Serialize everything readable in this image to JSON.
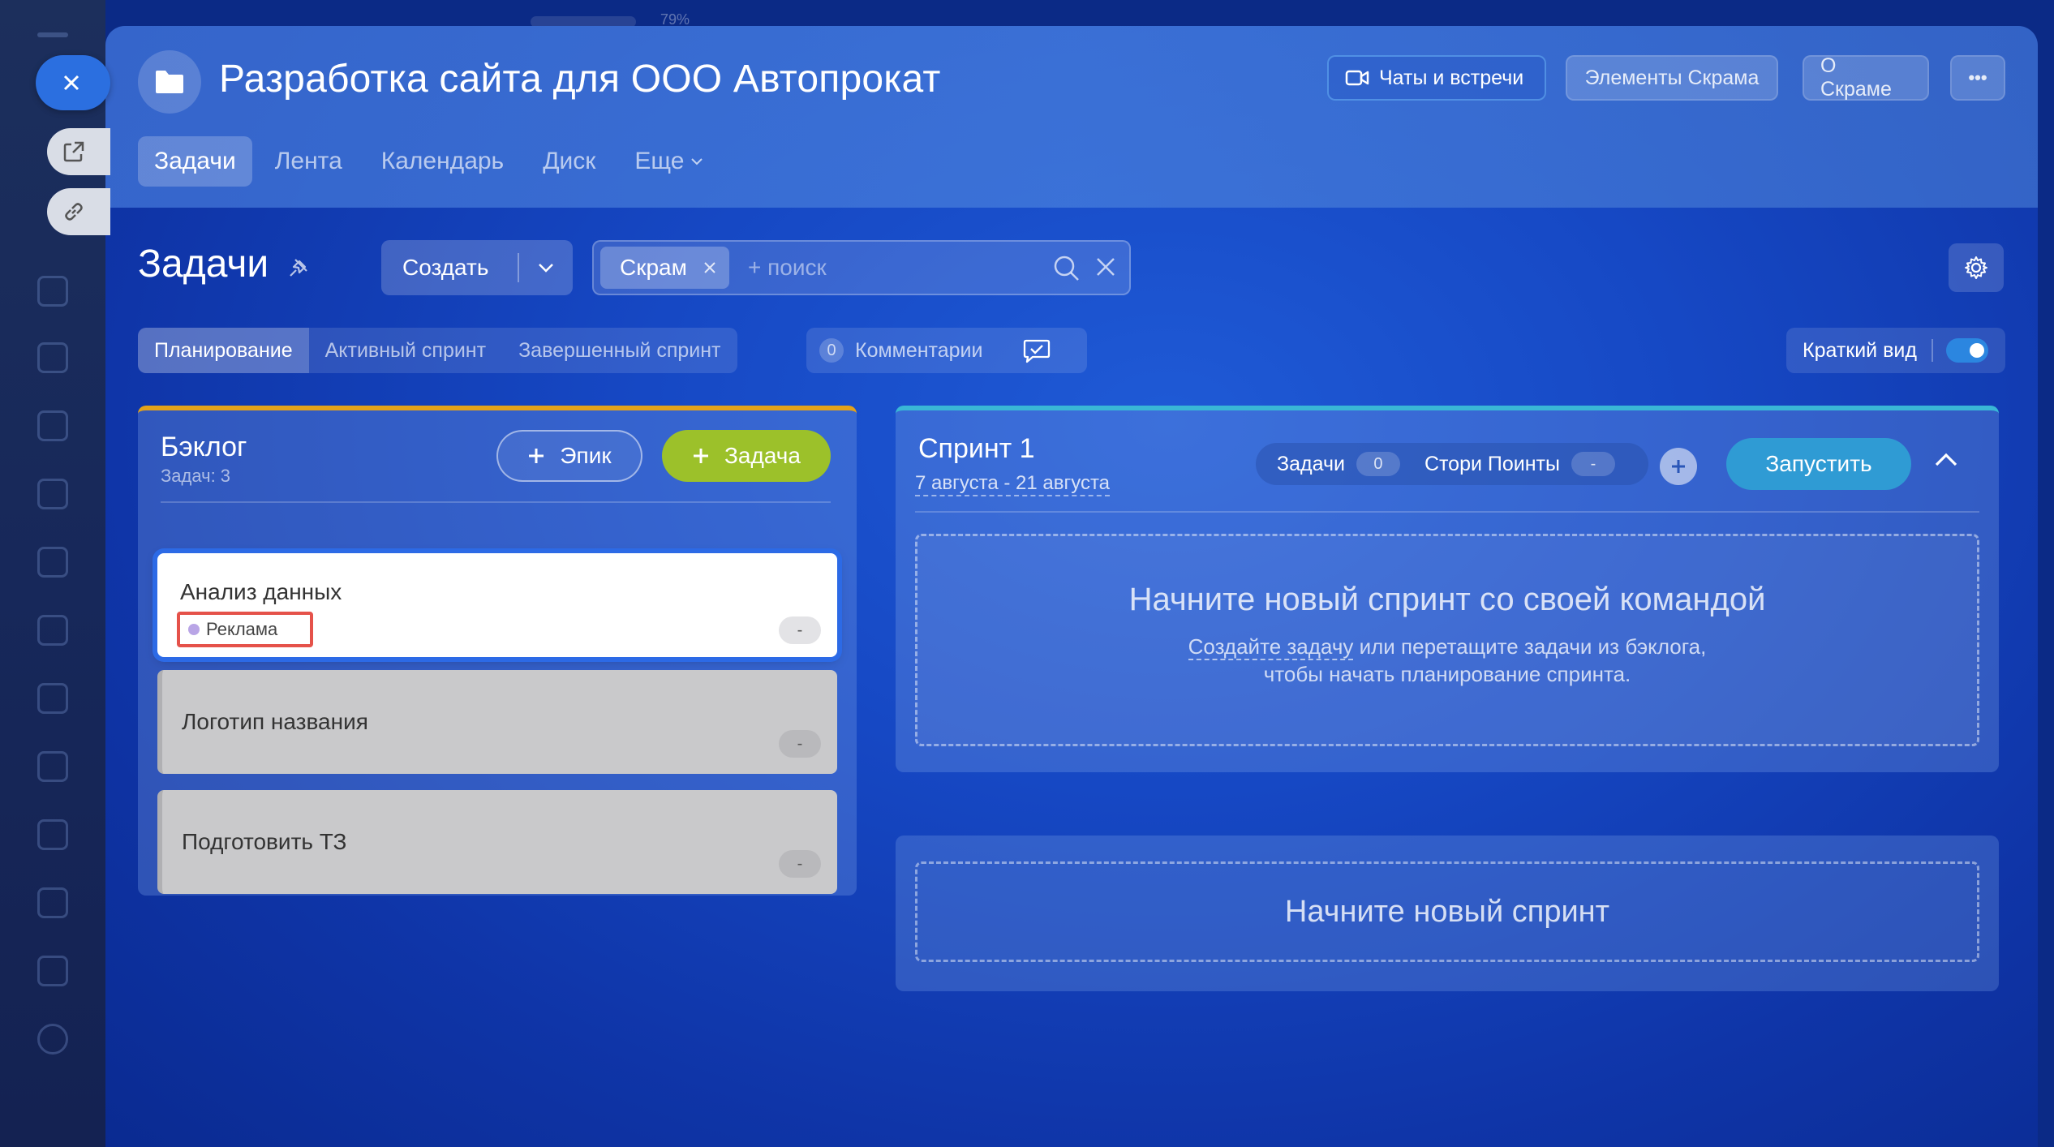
{
  "background": {
    "zoom_hint": "79%"
  },
  "header": {
    "project_title": "Разработка сайта для ООО Автопрокат",
    "buttons": {
      "chats": "Чаты и встречи",
      "scrum_elements": "Элементы Скрама",
      "about_scrum": "О Скраме",
      "more": "•••"
    },
    "tabs": [
      "Задачи",
      "Лента",
      "Календарь",
      "Диск",
      "Еще"
    ]
  },
  "toolbar": {
    "title": "Задачи",
    "create_label": "Создать",
    "filter_chip": "Скрам",
    "search_placeholder": "+ поиск"
  },
  "view_tabs": [
    "Планирование",
    "Активный спринт",
    "Завершенный спринт"
  ],
  "comments": {
    "count": "0",
    "label": "Комментарии"
  },
  "compact_view": {
    "label": "Краткий вид",
    "enabled": true
  },
  "backlog": {
    "title": "Бэклог",
    "count_label": "Задач: 3",
    "epic_button": "Эпик",
    "task_button": "Задача",
    "items": [
      {
        "title": "Анализ данных",
        "tag": "Реклама",
        "points": "-"
      },
      {
        "title": "Логотип названия",
        "points": "-"
      },
      {
        "title": "Подготовить ТЗ",
        "points": "-"
      }
    ]
  },
  "sprint": {
    "title": "Спринт 1",
    "dates": "7 августа - 21 августа",
    "tasks_label": "Задачи",
    "tasks_count": "0",
    "story_points_label": "Стори Поинты",
    "story_points_value": "-",
    "start_button": "Запустить",
    "empty_title": "Начните новый спринт со своей командой",
    "empty_link": "Создайте задачу",
    "empty_text_rest": " или перетащите задачи из бэклога,",
    "empty_text_line2": "чтобы начать планирование спринта."
  },
  "new_sprint": {
    "label": "Начните новый спринт"
  },
  "colors": {
    "accent_blue": "#2b6fe0",
    "task_green": "#9cc12a",
    "backlog_border": "#e3a21a",
    "sprint_border": "#39b7d6",
    "highlight_red": "#e5524a"
  }
}
